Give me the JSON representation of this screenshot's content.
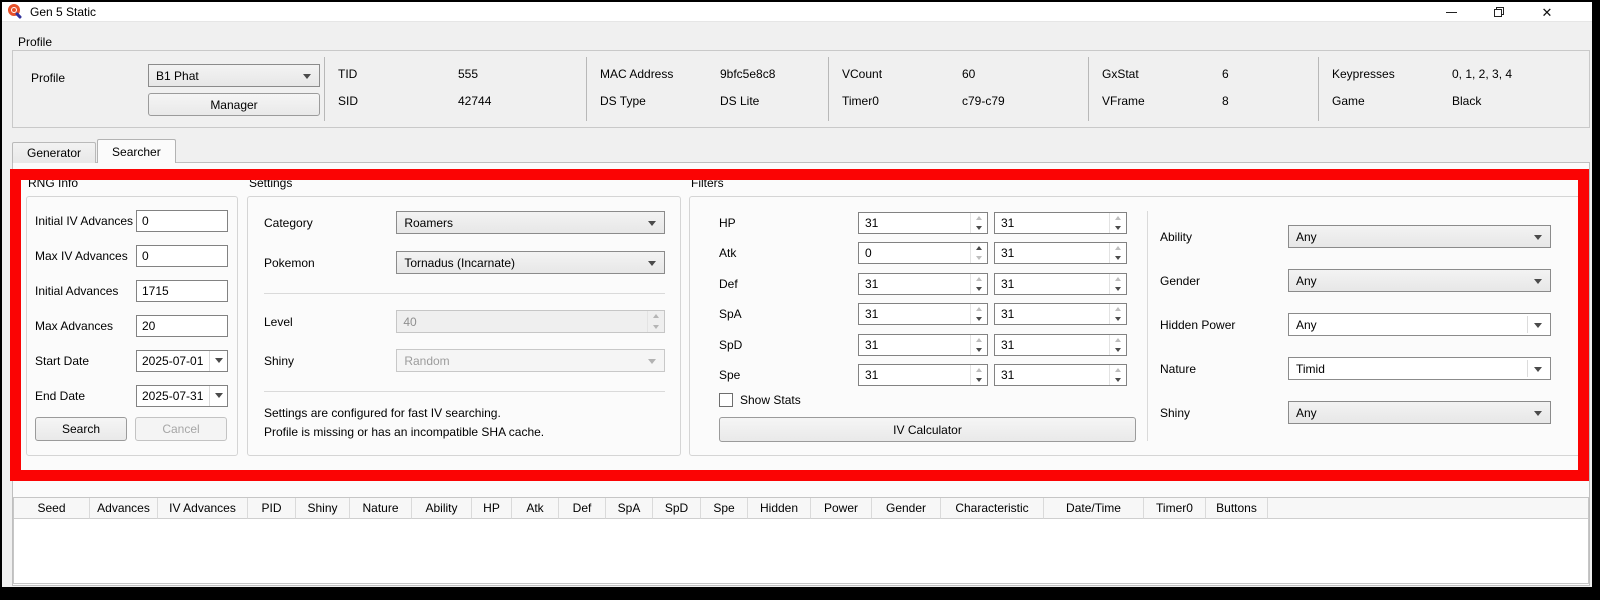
{
  "window": {
    "title": "Gen 5 Static"
  },
  "profile": {
    "section_label": "Profile",
    "field_label": "Profile",
    "selected": "B1 Phat",
    "manager_button": "Manager",
    "columns": [
      {
        "rows": [
          {
            "label": "TID",
            "value": "555"
          },
          {
            "label": "SID",
            "value": "42744"
          }
        ]
      },
      {
        "rows": [
          {
            "label": "MAC Address",
            "value": "9bfc5e8c8"
          },
          {
            "label": "DS Type",
            "value": "DS Lite"
          }
        ]
      },
      {
        "rows": [
          {
            "label": "VCount",
            "value": "60"
          },
          {
            "label": "Timer0",
            "value": "c79-c79"
          }
        ]
      },
      {
        "rows": [
          {
            "label": "GxStat",
            "value": "6"
          },
          {
            "label": "VFrame",
            "value": "8"
          }
        ]
      },
      {
        "rows": [
          {
            "label": "Keypresses",
            "value": "0, 1, 2, 3, 4"
          },
          {
            "label": "Game",
            "value": "Black"
          }
        ]
      }
    ]
  },
  "tabs": [
    {
      "label": "Generator",
      "active": false
    },
    {
      "label": "Searcher",
      "active": true
    }
  ],
  "rng_info": {
    "title": "RNG Info",
    "fields": [
      {
        "label": "Initial IV Advances",
        "value": "0",
        "type": "text"
      },
      {
        "label": "Max IV Advances",
        "value": "0",
        "type": "text"
      },
      {
        "label": "Initial Advances",
        "value": "1715",
        "type": "text"
      },
      {
        "label": "Max Advances",
        "value": "20",
        "type": "text"
      },
      {
        "label": "Start Date",
        "value": "2025-07-01",
        "type": "date"
      },
      {
        "label": "End Date",
        "value": "2025-07-31",
        "type": "date"
      }
    ],
    "search_button": "Search",
    "cancel_button": "Cancel"
  },
  "settings": {
    "title": "Settings",
    "category_label": "Category",
    "category_value": "Roamers",
    "pokemon_label": "Pokemon",
    "pokemon_value": "Tornadus (Incarnate)",
    "level_label": "Level",
    "level_value": "40",
    "shiny_label": "Shiny",
    "shiny_value": "Random",
    "messages": [
      "Settings are configured for fast IV searching.",
      "Profile is missing or has an incompatible SHA cache."
    ]
  },
  "filters": {
    "title": "Filters",
    "iv_rows": [
      {
        "label": "HP",
        "min": "31",
        "max": "31"
      },
      {
        "label": "Atk",
        "min": "0",
        "max": "31"
      },
      {
        "label": "Def",
        "min": "31",
        "max": "31"
      },
      {
        "label": "SpA",
        "min": "31",
        "max": "31"
      },
      {
        "label": "SpD",
        "min": "31",
        "max": "31"
      },
      {
        "label": "Spe",
        "min": "31",
        "max": "31"
      }
    ],
    "show_stats_label": "Show Stats",
    "iv_calculator_button": "IV Calculator",
    "dropdowns": [
      {
        "label": "Ability",
        "value": "Any",
        "style": "combo"
      },
      {
        "label": "Gender",
        "value": "Any",
        "style": "combo"
      },
      {
        "label": "Hidden Power",
        "value": "Any",
        "style": "combo-edit"
      },
      {
        "label": "Nature",
        "value": "Timid",
        "style": "combo-edit"
      },
      {
        "label": "Shiny",
        "value": "Any",
        "style": "combo"
      }
    ]
  },
  "results_table": {
    "columns": [
      "Seed",
      "Advances",
      "IV Advances",
      "PID",
      "Shiny",
      "Nature",
      "Ability",
      "HP",
      "Atk",
      "Def",
      "SpA",
      "SpD",
      "Spe",
      "Hidden",
      "Power",
      "Gender",
      "Characteristic",
      "Date/Time",
      "Timer0",
      "Buttons"
    ],
    "sort_column": "Seed",
    "rows": []
  },
  "annotation_color": "#fb0404"
}
